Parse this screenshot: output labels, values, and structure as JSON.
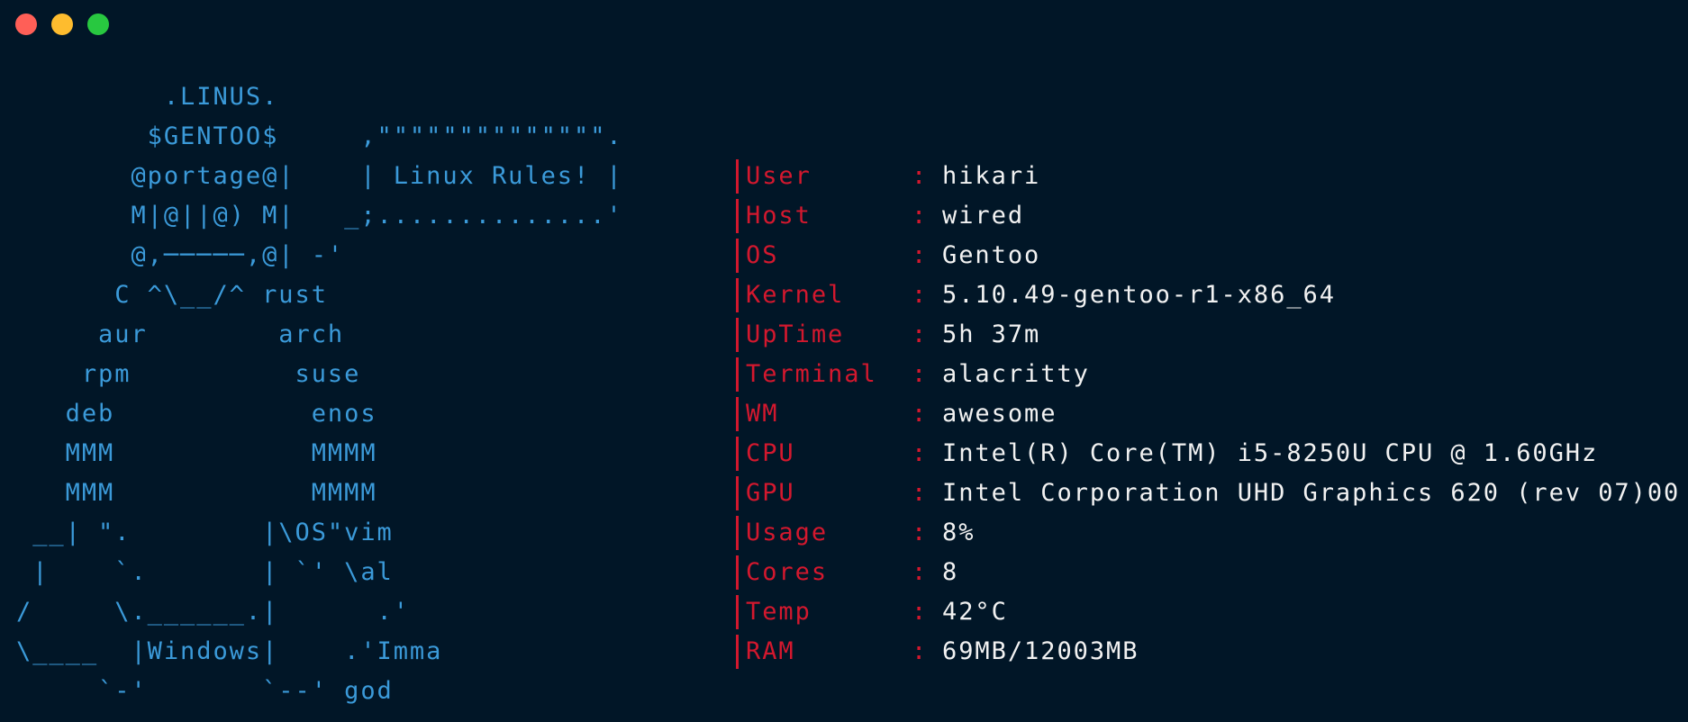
{
  "window": {
    "controls": [
      "close",
      "minimize",
      "maximize"
    ]
  },
  "colors": {
    "background": "#011627",
    "ascii": "#3b9ad9",
    "label": "#d3182e",
    "value": "#f2f2f2",
    "close": "#ff5f57",
    "minimize": "#febc2e",
    "maximize": "#28c840"
  },
  "ascii_art": [
    "         .LINUS.",
    "        $GENTOO$     ,\"\"\"\"\"\"\"\"\"\"\"\"\"\".",
    "       @portage@|    | Linux Rules! |",
    "       M|@||@) M|   _;..............'",
    "       @,─────,@| -'",
    "      C ^\\__/^ rust",
    "     aur        arch",
    "    rpm          suse",
    "   deb            enos",
    "   MMM            MMMM",
    "   MMM            MMMM",
    " __| \".        |\\OS\"vim",
    " |    `.       | `' \\al",
    "/     \\.______.|      .'",
    "\\____  |Windows|    .'Imma",
    "     `-'       `--' god"
  ],
  "info": {
    "separator": ":",
    "rows": [
      {
        "label": "User",
        "value": "hikari"
      },
      {
        "label": "Host",
        "value": "wired"
      },
      {
        "label": "OS",
        "value": "Gentoo"
      },
      {
        "label": "Kernel",
        "value": "5.10.49-gentoo-r1-x86_64"
      },
      {
        "label": "UpTime",
        "value": "5h 37m"
      },
      {
        "label": "Terminal",
        "value": "alacritty"
      },
      {
        "label": "WM",
        "value": "awesome"
      },
      {
        "label": "CPU",
        "value": "Intel(R) Core(TM) i5-8250U CPU @ 1.60GHz"
      },
      {
        "label": "GPU",
        "value": "Intel Corporation UHD Graphics 620 (rev 07)00"
      },
      {
        "label": "Usage",
        "value": "8%"
      },
      {
        "label": "Cores",
        "value": "8"
      },
      {
        "label": "Temp",
        "value": "42°C"
      },
      {
        "label": "RAM",
        "value": "69MB/12003MB"
      }
    ]
  }
}
